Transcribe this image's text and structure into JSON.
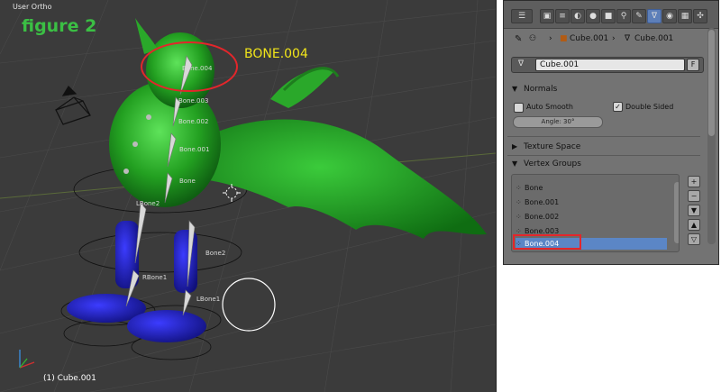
{
  "viewport": {
    "title": "User Ortho",
    "figure_label": "figure 2",
    "callout": "BONE.004",
    "object_status": "(1) Cube.001",
    "bone_labels": [
      "Bone.004",
      "Bone.003",
      "Bone.002",
      "Bone.001",
      "Bone",
      "LBone2",
      "Bone2",
      "RBone1",
      "LBone1"
    ]
  },
  "properties": {
    "breadcrumb": {
      "object": "Cube.001",
      "mesh": "Cube.001",
      "separator": "›"
    },
    "mesh_name": "Cube.001",
    "fake_user": "F",
    "normals": {
      "title": "Normals",
      "auto_smooth": {
        "label": "Auto Smooth",
        "checked": false
      },
      "double_sided": {
        "label": "Double Sided",
        "checked": true
      },
      "angle": "Angle: 30°"
    },
    "texture_space": {
      "title": "Texture Space"
    },
    "vertex_groups": {
      "title": "Vertex Groups",
      "items": [
        "Bone",
        "Bone.001",
        "Bone.002",
        "Bone.003",
        "Bone.004"
      ],
      "selected": "Bone.004",
      "buttons": [
        "+",
        "−",
        "▼",
        "▲",
        "▽"
      ]
    }
  },
  "colors": {
    "accent": "#5b86c6",
    "highlight": "#e3262b",
    "callout": "#f1e51a",
    "figure": "#3bbf44"
  }
}
